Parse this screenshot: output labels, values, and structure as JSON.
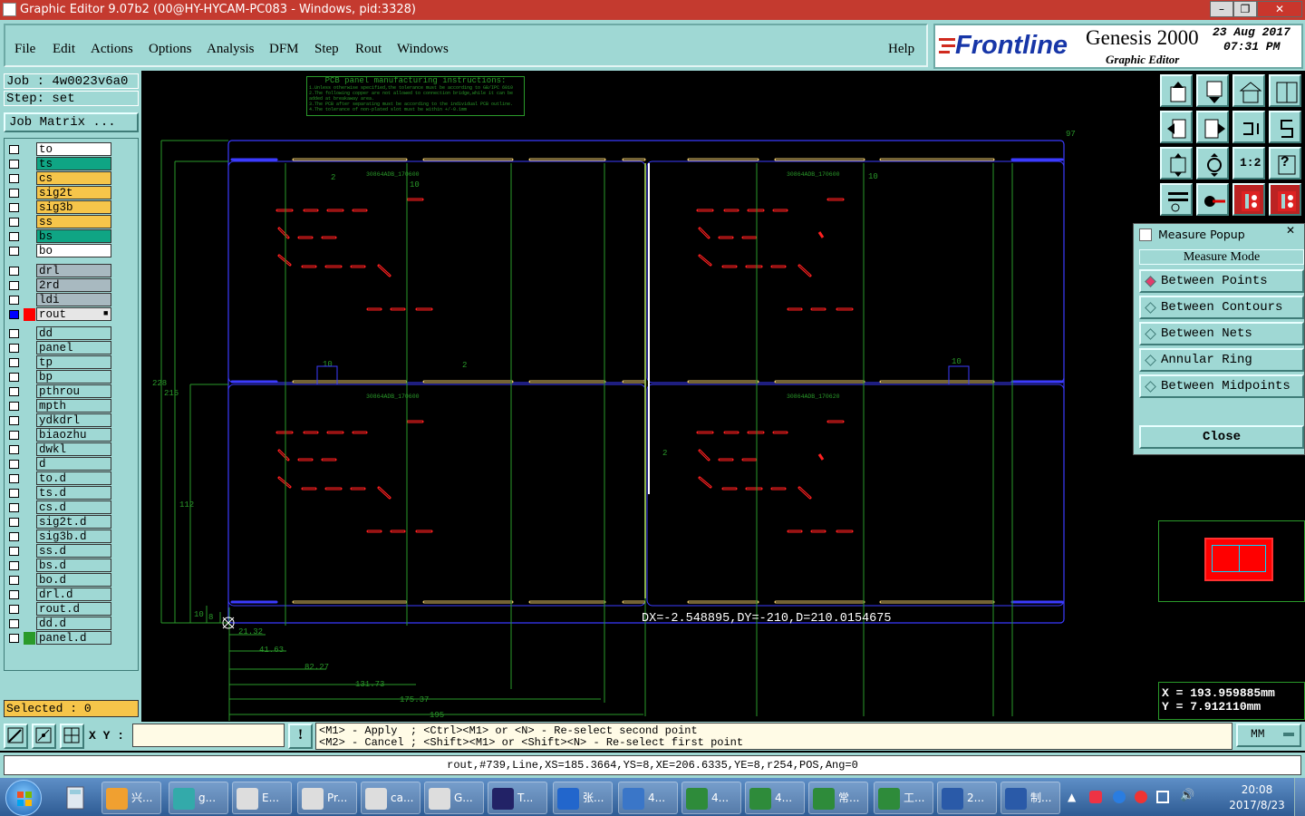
{
  "window": {
    "title": "Graphic Editor 9.07b2 (00@HY-HYCAM-PC083 - Windows, pid:3328)",
    "min_label": "–",
    "max_label": "❐",
    "close_label": "✕"
  },
  "menu": {
    "items": [
      "File",
      "Edit",
      "Actions",
      "Options",
      "Analysis",
      "DFM",
      "Step",
      "Rout",
      "Windows"
    ],
    "help": "Help"
  },
  "branding": {
    "logo": "Frontline",
    "product": "Genesis 2000",
    "subtitle": "Graphic Editor",
    "date": "23 Aug 2017",
    "time": "07:31 PM"
  },
  "job": {
    "job_label": "Job : 4w0023v6a0",
    "step_label": "Step: set",
    "matrix_button": "Job Matrix ..."
  },
  "layers": [
    {
      "name": "to",
      "color": "#ffffff",
      "checked_style": "white"
    },
    {
      "name": "ts",
      "color": "#0fa584",
      "checked_style": "white"
    },
    {
      "name": "cs",
      "color": "#f6c54a",
      "checked_style": "white"
    },
    {
      "name": "sig2t",
      "color": "#f6c54a",
      "checked_style": "white"
    },
    {
      "name": "sig3b",
      "color": "#f6c54a",
      "checked_style": "white"
    },
    {
      "name": "ss",
      "color": "#f6c54a",
      "checked_style": "white"
    },
    {
      "name": "bs",
      "color": "#0fa584",
      "checked_style": "white"
    },
    {
      "name": "bo",
      "color": "#ffffff",
      "checked_style": "white"
    },
    {
      "name": "drl",
      "color": "#a8b9c0",
      "checked_style": "white"
    },
    {
      "name": "2rd",
      "color": "#a8b9c0",
      "checked_style": "white"
    },
    {
      "name": "ldi",
      "color": "#a8b9c0",
      "checked_style": "white"
    },
    {
      "name": "rout",
      "color": "#e6e6e6",
      "checked_style": "blue",
      "swatch": "#ff0000",
      "mark": "■"
    },
    {
      "name": "dd",
      "color": "#9fd8d4",
      "checked_style": "white"
    },
    {
      "name": "panel",
      "color": "#9fd8d4",
      "checked_style": "white"
    },
    {
      "name": "tp",
      "color": "#9fd8d4",
      "checked_style": "white"
    },
    {
      "name": "bp",
      "color": "#9fd8d4",
      "checked_style": "white"
    },
    {
      "name": "pthrou",
      "color": "#9fd8d4",
      "checked_style": "white"
    },
    {
      "name": "mpth",
      "color": "#9fd8d4",
      "checked_style": "white"
    },
    {
      "name": "ydkdrl",
      "color": "#9fd8d4",
      "checked_style": "white"
    },
    {
      "name": "biaozhu",
      "color": "#9fd8d4",
      "checked_style": "white"
    },
    {
      "name": "dwkl",
      "color": "#9fd8d4",
      "checked_style": "white"
    },
    {
      "name": "d",
      "color": "#9fd8d4",
      "checked_style": "white"
    },
    {
      "name": "to.d",
      "color": "#9fd8d4",
      "checked_style": "white"
    },
    {
      "name": "ts.d",
      "color": "#9fd8d4",
      "checked_style": "white"
    },
    {
      "name": "cs.d",
      "color": "#9fd8d4",
      "checked_style": "white"
    },
    {
      "name": "sig2t.d",
      "color": "#9fd8d4",
      "checked_style": "white"
    },
    {
      "name": "sig3b.d",
      "color": "#9fd8d4",
      "checked_style": "white"
    },
    {
      "name": "ss.d",
      "color": "#9fd8d4",
      "checked_style": "white"
    },
    {
      "name": "bs.d",
      "color": "#9fd8d4",
      "checked_style": "white"
    },
    {
      "name": "bo.d",
      "color": "#9fd8d4",
      "checked_style": "white"
    },
    {
      "name": "drl.d",
      "color": "#9fd8d4",
      "checked_style": "white"
    },
    {
      "name": "rout.d",
      "color": "#9fd8d4",
      "checked_style": "white"
    },
    {
      "name": "dd.d",
      "color": "#9fd8d4",
      "checked_style": "white"
    },
    {
      "name": "panel.d",
      "color": "#9fd8d4",
      "checked_style": "white",
      "swatch": "#2a9a2a"
    }
  ],
  "selected": "Selected : 0",
  "canvas": {
    "instructions_title": "PCB panel manufacturing instructions:",
    "instruction_lines": [
      "1.Unless otherwise specified,the tolerance must be according to GB/IPC 6010",
      "2.The following copper are not allowed to connection bridge,while it can be added at breakaway area.",
      "3.The PCB after separating must be according to the individual PCB outline.",
      "4.The tolerance of non-plated slot must be within +/-0.1mm"
    ],
    "board_labels": [
      "30864ADB_170600",
      "30864ADB_170600",
      "30864ADB_170600",
      "30864ADB_170620"
    ],
    "dim_top_right": "97",
    "dims_small": [
      "2",
      "10",
      "10",
      "10",
      "2",
      "10",
      "2",
      "10",
      "8"
    ],
    "dims_left": [
      "228",
      "215",
      "112"
    ],
    "dims_bottom": [
      "21.32",
      "41.63",
      "82.27",
      "131.73",
      "175.37",
      "195"
    ],
    "readout": "DX=-2.548895,DY=-210,D=210.0154675"
  },
  "toolbar_icons": [
    "save-up-icon",
    "load-down-icon",
    "home-icon",
    "window-icon",
    "door-left-icon",
    "door-right-icon",
    "swap-icon",
    "snake-icon",
    "fit-icon",
    "zoom-icon",
    "ratio-label",
    "help-icon",
    "tools-icon",
    "probe-icon",
    "layers-red-icon",
    "layers-red2-icon"
  ],
  "ratio_text": "1:2",
  "help_text": "?",
  "popup": {
    "title": "Measure Popup",
    "close_x": "✕",
    "mode_label": "Measure Mode",
    "options": [
      {
        "label": "Between Points",
        "selected": true
      },
      {
        "label": "Between Contours",
        "selected": false
      },
      {
        "label": "Between Nets",
        "selected": false
      },
      {
        "label": "Annular Ring",
        "selected": false
      },
      {
        "label": "Between Midpoints",
        "selected": false
      }
    ],
    "close_button": "Close"
  },
  "coords": {
    "x_label": "X = 193.959885mm",
    "y_label": "Y = 7.912110mm"
  },
  "command": {
    "xy_label": "X Y :",
    "xy_value": "",
    "warn": "!",
    "hint1": "<M1> - Apply  ; <Ctrl><M1> or <N> - Re-select second point",
    "hint2": "<M2> - Cancel ; <Shift><M1> or <Shift><N> - Re-select first point",
    "units": "MM"
  },
  "status": "rout,#739,Line,XS=185.3664,YS=8,XE=206.6335,YE=8,r254,POS,Ang=0",
  "taskbar": {
    "items": [
      "兴...",
      "g...",
      "E...",
      "Pr...",
      "ca...",
      "G...",
      "T...",
      "张...",
      "4...",
      "4...",
      "4...",
      "常...",
      "工...",
      "2...",
      "制..."
    ],
    "time": "20:08",
    "date": "2017/8/23"
  }
}
